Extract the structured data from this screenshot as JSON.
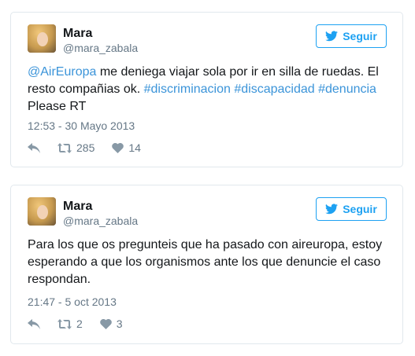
{
  "tweets": [
    {
      "name": "Mara",
      "handle": "@mara_zabala",
      "follow_label": "Seguir",
      "text_parts": [
        {
          "text": "@AirEuropa",
          "link": true
        },
        {
          "text": " me deniega viajar sola por ir en silla de ruedas. El resto compañias ok. ",
          "link": false
        },
        {
          "text": "#discriminacion",
          "link": true
        },
        {
          "text": " ",
          "link": false
        },
        {
          "text": "#discapacidad",
          "link": true
        },
        {
          "text": " ",
          "link": false
        },
        {
          "text": "#denuncia",
          "link": true
        },
        {
          "text": " Please RT",
          "link": false
        }
      ],
      "time": "12:53 - 30 Mayo 2013",
      "retweets": "285",
      "likes": "14"
    },
    {
      "name": "Mara",
      "handle": "@mara_zabala",
      "follow_label": "Seguir",
      "text_parts": [
        {
          "text": "Para los que os pregunteis que ha pasado con aireuropa, estoy esperando a que los organismos ante los que denuncie el caso respondan.",
          "link": false
        }
      ],
      "time": "21:47 - 5 oct 2013",
      "retweets": "2",
      "likes": "3"
    }
  ],
  "colors": {
    "accent": "#1da1f2",
    "link": "#3b94d9",
    "muted": "#657786"
  },
  "icons": [
    "twitter-bird-icon",
    "reply-icon",
    "retweet-icon",
    "heart-icon"
  ]
}
